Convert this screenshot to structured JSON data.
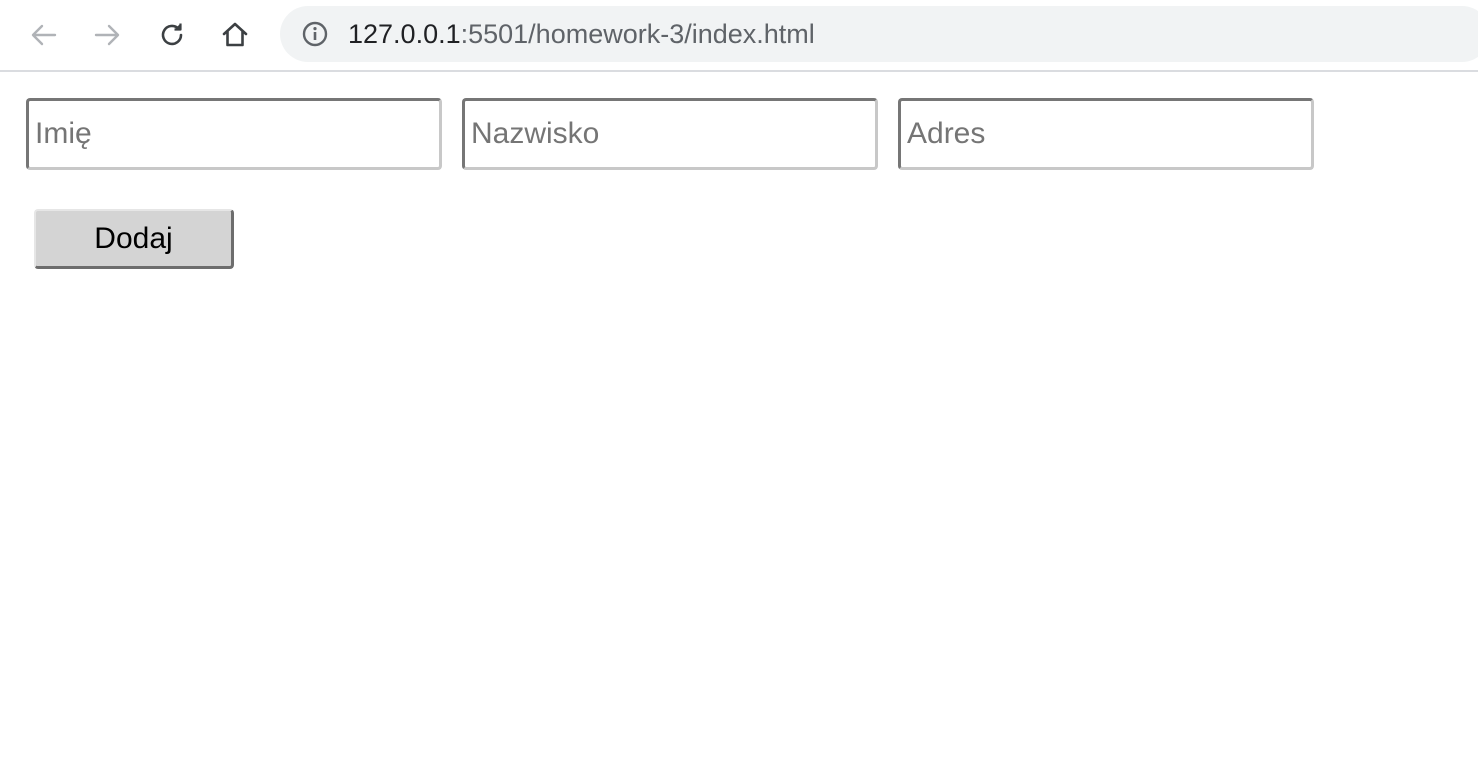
{
  "browser": {
    "back_icon": "arrow-left-icon",
    "forward_icon": "arrow-right-icon",
    "reload_icon": "reload-icon",
    "home_icon": "home-icon",
    "info_icon": "info-icon",
    "url_host": "127.0.0.1",
    "url_rest": ":5501/homework-3/index.html",
    "colors": {
      "omnibox_bg": "#f1f3f4",
      "icon_disabled": "#b0b3b7",
      "icon_active": "#5f6368"
    }
  },
  "form": {
    "first_name_placeholder": "Imię",
    "last_name_placeholder": "Nazwisko",
    "address_placeholder": "Adres",
    "add_button_label": "Dodaj"
  }
}
